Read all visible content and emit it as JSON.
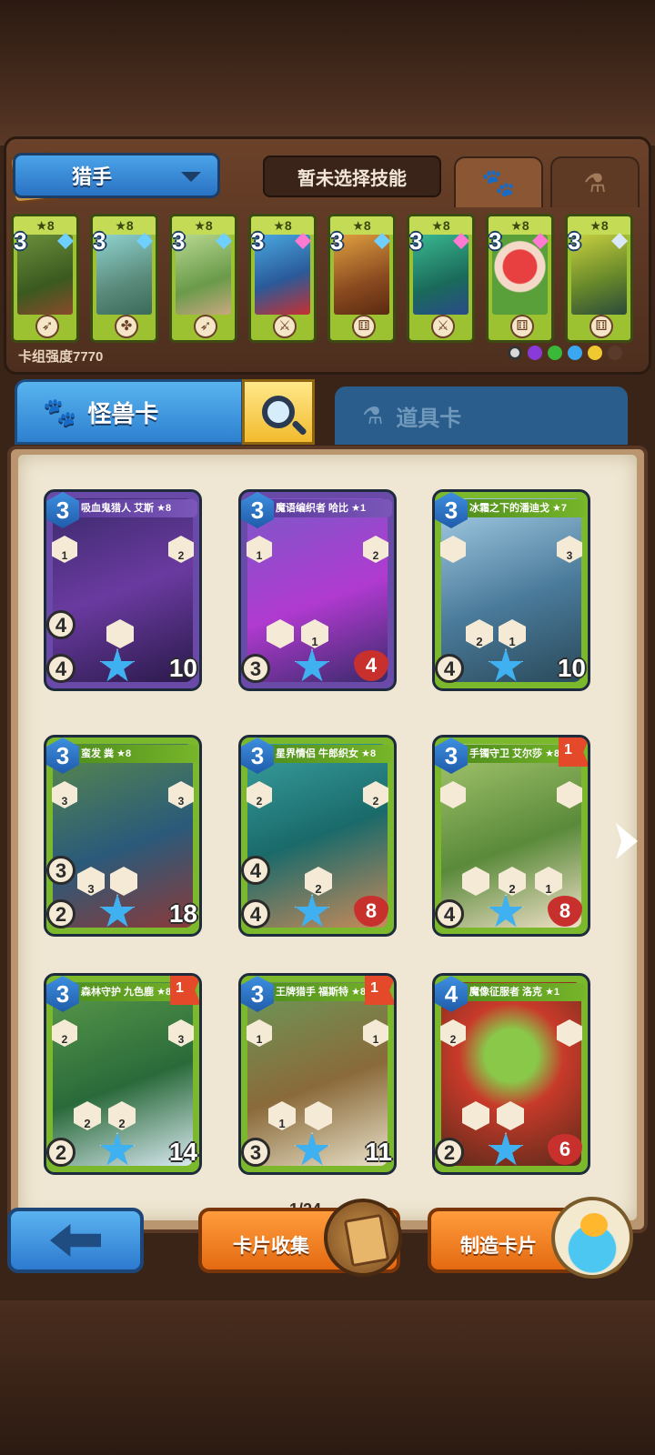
{
  "header": {
    "class_name": "猎手",
    "skill_label": "暂未选择技能",
    "deck_strength": "卡组强度7770"
  },
  "deck": [
    {
      "cost": "3",
      "stars": "★8",
      "weapon": "bow"
    },
    {
      "cost": "3",
      "stars": "★8",
      "weapon": "clover"
    },
    {
      "cost": "3",
      "stars": "★8",
      "weapon": "bow"
    },
    {
      "cost": "3",
      "stars": "★8",
      "weapon": "sword"
    },
    {
      "cost": "3",
      "stars": "★8",
      "weapon": "dice"
    },
    {
      "cost": "3",
      "stars": "★8",
      "weapon": "sword"
    },
    {
      "cost": "3",
      "stars": "★8",
      "weapon": "dice"
    },
    {
      "cost": "3",
      "stars": "★8",
      "weapon": "dice"
    }
  ],
  "tabs": {
    "monster": "怪兽卡",
    "item": "道具卡"
  },
  "cards": [
    {
      "name": "吸血鬼猎人 艾斯 ★8",
      "cost": "3",
      "atk_a": "4",
      "atk_b": "4",
      "hp": "10",
      "left_val": "1",
      "right_val": "2",
      "skills": [
        ""
      ],
      "color": "purple",
      "flag": ""
    },
    {
      "name": "魔语编织者 哈比 ★1",
      "cost": "3",
      "atk_a": "",
      "atk_b": "3",
      "hp": "4",
      "left_val": "1",
      "right_val": "2",
      "skills": [
        "",
        "1"
      ],
      "color": "purple",
      "flag": ""
    },
    {
      "name": "冰霜之下的潘迪戈 ★7",
      "cost": "3",
      "atk_a": "4",
      "atk_b": "4",
      "hp": "10",
      "left_val": "",
      "right_val": "3",
      "skills": [
        "2",
        "1"
      ],
      "color": "green",
      "flag": ""
    },
    {
      "name": "蛮发 粪 ★8",
      "cost": "3",
      "atk_a": "3",
      "atk_b": "2",
      "hp": "18",
      "left_val": "3",
      "right_val": "3",
      "skills": [
        "3",
        ""
      ],
      "color": "green",
      "flag": ""
    },
    {
      "name": "星界情侣 牛郎织女 ★8",
      "cost": "3",
      "atk_a": "4",
      "atk_b": "4",
      "hp": "8",
      "left_val": "2",
      "right_val": "2",
      "skills": [
        "2"
      ],
      "color": "green",
      "flag": ""
    },
    {
      "name": "手镯守卫 艾尔莎 ★8",
      "cost": "3",
      "atk_a": "",
      "atk_b": "4",
      "hp": "8",
      "left_val": "",
      "right_val": "",
      "skills": [
        "",
        "2",
        "1"
      ],
      "color": "green",
      "flag": "1"
    },
    {
      "name": "森林守护 九色鹿 ★8",
      "cost": "3",
      "atk_a": "",
      "atk_b": "2",
      "hp": "14",
      "left_val": "2",
      "right_val": "3",
      "skills": [
        "2",
        "2"
      ],
      "color": "green",
      "flag": "1"
    },
    {
      "name": "王牌猎手 福斯特 ★8",
      "cost": "3",
      "atk_a": "",
      "atk_b": "3",
      "hp": "11",
      "left_val": "1",
      "right_val": "1",
      "skills": [
        "1",
        ""
      ],
      "color": "green",
      "flag": "1"
    },
    {
      "name": "魔像征服者 洛克 ★1",
      "cost": "4",
      "atk_a": "",
      "atk_b": "2",
      "hp": "6",
      "left_val": "2",
      "right_val": "",
      "skills": [
        "",
        ""
      ],
      "color": "green",
      "flag": ""
    }
  ],
  "pager": "1/24",
  "buttons": {
    "collect": "卡片收集",
    "craft": "制造卡片"
  },
  "colors": {
    "accent_blue": "#2e80d0",
    "accent_orange": "#e46a12",
    "card_green": "#7bb82c",
    "card_purple": "#6a4aa8"
  }
}
